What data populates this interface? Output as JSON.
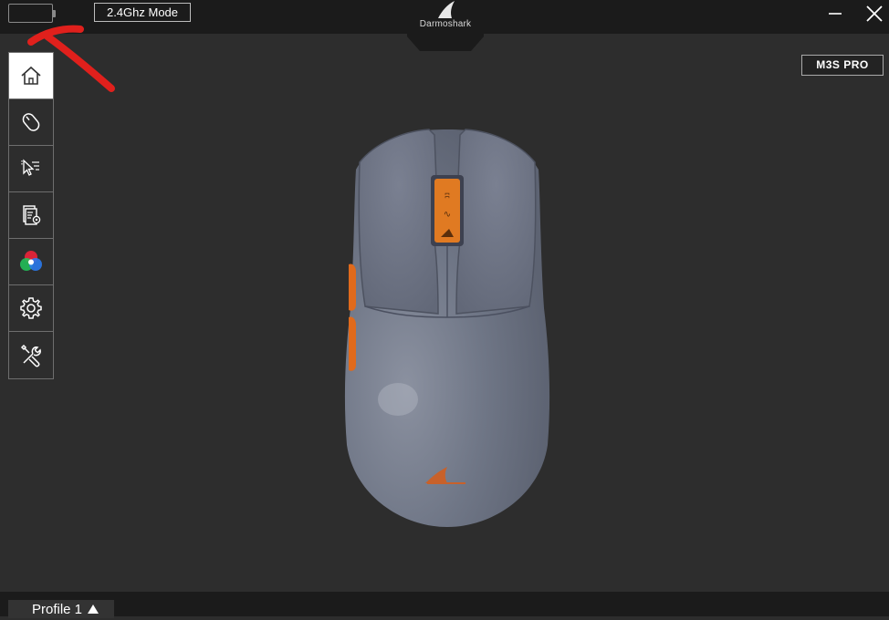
{
  "header": {
    "mode_label": "2.4Ghz Mode",
    "brand": "Darmoshark"
  },
  "model_badge": "M3S PRO",
  "sidebar": {
    "items": [
      {
        "icon": "home-icon",
        "active": true
      },
      {
        "icon": "mouse-icon",
        "active": false
      },
      {
        "icon": "pointer-settings-icon",
        "active": false
      },
      {
        "icon": "macro-settings-icon",
        "active": false
      },
      {
        "icon": "rgb-lighting-icon",
        "active": false
      },
      {
        "icon": "gear-icon",
        "active": false
      },
      {
        "icon": "tools-icon",
        "active": false
      }
    ]
  },
  "footer": {
    "profile_label": "Profile 1"
  },
  "colors": {
    "topbar": "#1b1b1b",
    "background": "#2d2d2d",
    "mouse_body": "#6b7181",
    "accent_orange": "#e06a1c",
    "annotation_red": "#e0201c"
  }
}
